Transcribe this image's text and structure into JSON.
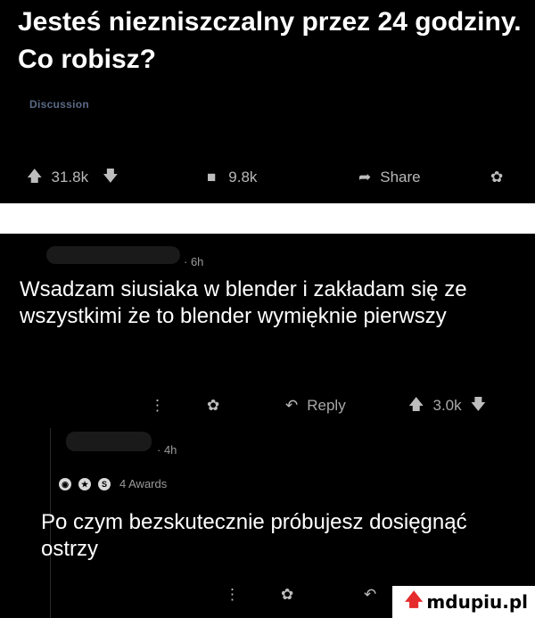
{
  "post": {
    "title": "Jesteś niezniszczalny przez 24 godziny. Co robisz?",
    "flair": "Discussion",
    "upvotes": "31.8k",
    "comments": "9.8k",
    "share_label": "Share"
  },
  "comments": [
    {
      "age": "6h",
      "text": "Wsadzam siusiaka w blender i zakładam się ze wszystkimi że to blender wymięknie pierwszy",
      "reply_label": "Reply",
      "score": "3.0k"
    },
    {
      "age": "4h",
      "awards": "4 Awards",
      "award_letter": "S",
      "text": "Po czym bezskutecznie próbujesz dosięgnąć ostrzy"
    }
  ],
  "watermark": {
    "text": "mdupiu.pl"
  },
  "colors": {
    "background": "#000000",
    "text": "#ffffff",
    "muted": "#a8a8a8",
    "flair": "#5a6a86",
    "watermark_arrow": "#e52b2b"
  },
  "icons": [
    "upvote-icon",
    "downvote-icon",
    "comment-icon",
    "share-icon",
    "award-icon",
    "more-icon",
    "reply-icon"
  ]
}
